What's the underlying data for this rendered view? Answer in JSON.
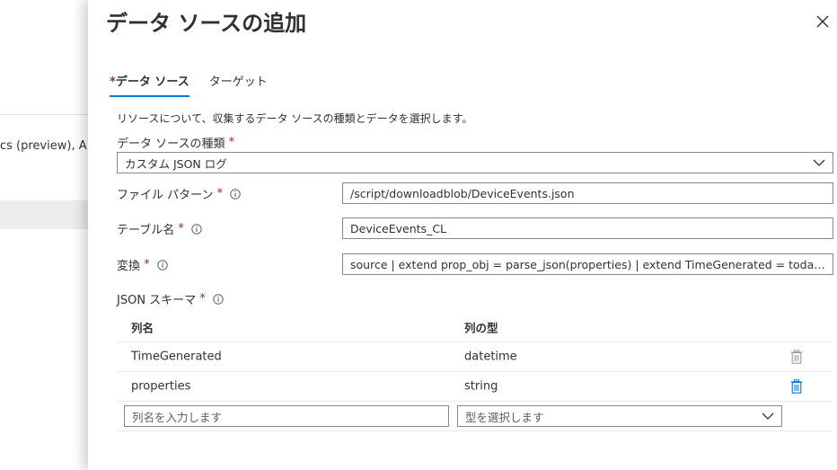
{
  "background": {
    "fragment_text": "cs (preview), A:"
  },
  "panel": {
    "title": "データ ソースの追加",
    "close_icon": "close-icon"
  },
  "tabs": [
    {
      "label": "データ ソース",
      "required": "*",
      "active": true
    },
    {
      "label": "ターゲット",
      "active": false
    }
  ],
  "description": "リソースについて、収集するデータ ソースの種類とデータを選択します。",
  "form": {
    "source_type": {
      "label": "データ ソースの種類",
      "required": "*",
      "value": "カスタム JSON ログ"
    },
    "file_pattern": {
      "label": "ファイル パターン",
      "required": "*",
      "value": "/script/downloadblob/DeviceEvents.json"
    },
    "table_name": {
      "label": "テーブル名",
      "required": "*",
      "value": "DeviceEvents_CL"
    },
    "transform": {
      "label": "変換",
      "required": "*",
      "value": "source | extend prop_obj = parse_json(properties) | extend TimeGenerated = todatetime(prop_obj.timestamp)"
    }
  },
  "schema": {
    "label": "JSON スキーマ",
    "required": "*",
    "columns": [
      "列名",
      "列の型"
    ],
    "rows": [
      {
        "name": "TimeGenerated",
        "type": "datetime",
        "deletable": false
      },
      {
        "name": "properties",
        "type": "string",
        "deletable": true
      }
    ],
    "new_row": {
      "name_placeholder": "列名を入力します",
      "type_placeholder": "型を選択します"
    }
  },
  "colors": {
    "accent": "#0078d4",
    "required": "#a4262c",
    "disabled_icon": "#a19f9d"
  }
}
